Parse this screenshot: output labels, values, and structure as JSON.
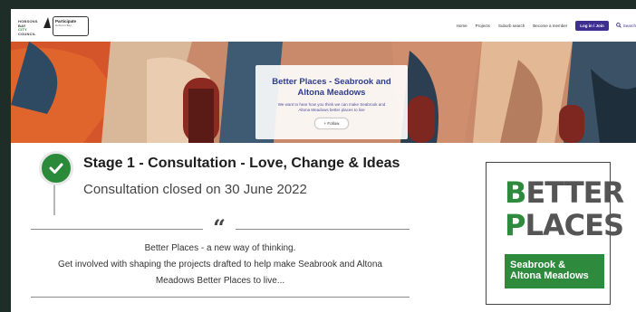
{
  "header": {
    "council_logo": {
      "line1": "HOBSONS",
      "line2": "BAY",
      "line3": "CITY",
      "line4": "COUNCIL"
    },
    "participate_logo": {
      "title": "Participate",
      "subtitle": "Hobsons Bay"
    },
    "nav": {
      "home": "Home",
      "projects": "Projects",
      "suburb_search": "Suburb search",
      "become_member": "Become a member",
      "login": "Log in / Join",
      "search": "Search"
    }
  },
  "hero": {
    "title": "Better Places - Seabrook and Altona Meadows",
    "description": "We want to hear how you think we can make Seabrook and Altona Meadows better places to live",
    "follow_label": "+ Follow"
  },
  "stage": {
    "title": "Stage 1 - Consultation - Love, Change & Ideas",
    "status": "Consultation closed on 30 June 2022",
    "icon": "check-icon",
    "color": "#2a8a3a"
  },
  "quote": {
    "mark": "“",
    "lines": [
      "Better Places - a new way of thinking.",
      "Get involved with shaping the projects drafted to help make Seabrook and Altona",
      "Meadows Better Places to live..."
    ]
  },
  "better_places_logo": {
    "line1": "BETTER",
    "line2": "PLACES",
    "banner_line1": "Seabrook &",
    "banner_line2": "Altona Meadows",
    "accent": "#2e8b3e"
  }
}
